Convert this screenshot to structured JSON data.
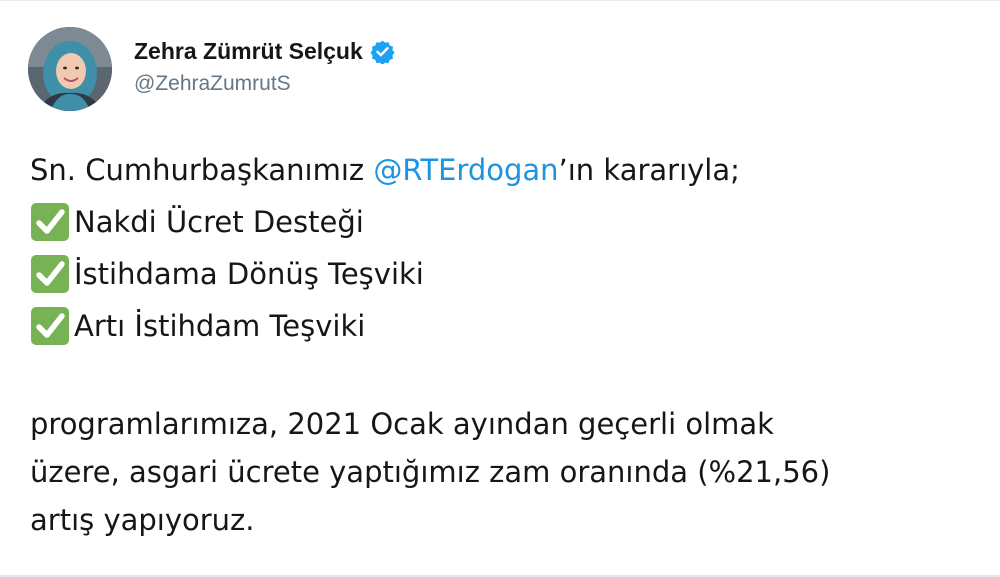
{
  "user": {
    "name": "Zehra Zümrüt Selçuk",
    "handle": "@ZehraZumrutS",
    "verified": true,
    "avatar_alt": "profile photo"
  },
  "tweet": {
    "intro_prefix": "Sn. Cumhurbaşkanımız ",
    "mention": "@RTErdogan",
    "intro_suffix": "’ın kararıyla;",
    "checklist": [
      "Nakdi Ücret Desteği",
      "İstihdama Dönüş Teşviki",
      "Artı İstihdam Teşviki"
    ],
    "paragraph_lines": [
      "programlarımıza, 2021 Ocak ayından geçerli olmak",
      "üzere, asgari ücrete yaptığımız zam oranında (%21,56)",
      "artış yapıyoruz."
    ]
  },
  "colors": {
    "text": "#14171a",
    "handle": "#657786",
    "link": "#1b95e0",
    "verified_badge": "#1da1f2",
    "check_box": "#77b255"
  },
  "icons": {
    "verified": "verified-badge-icon",
    "check": "check-mark-button-icon"
  }
}
